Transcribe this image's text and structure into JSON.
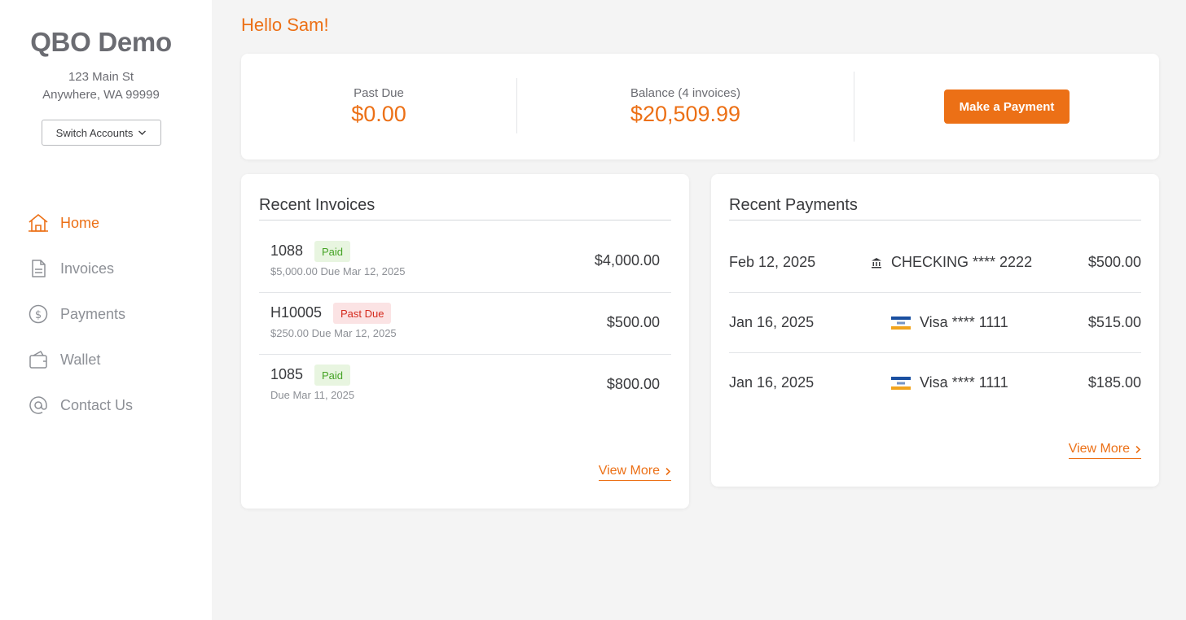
{
  "sidebar": {
    "company_name": "QBO Demo",
    "address_line1": "123 Main St",
    "address_line2": "Anywhere, WA 99999",
    "switch_accounts_label": "Switch Accounts",
    "nav": [
      {
        "label": "Home",
        "icon": "home-icon",
        "active": true
      },
      {
        "label": "Invoices",
        "icon": "document-icon",
        "active": false
      },
      {
        "label": "Payments",
        "icon": "dollar-circle-icon",
        "active": false
      },
      {
        "label": "Wallet",
        "icon": "wallet-icon",
        "active": false
      },
      {
        "label": "Contact Us",
        "icon": "at-icon",
        "active": false
      }
    ]
  },
  "greeting": "Hello Sam!",
  "summary": {
    "past_due_label": "Past Due",
    "past_due_value": "$0.00",
    "balance_label": "Balance (4 invoices)",
    "balance_value": "$20,509.99",
    "make_payment_label": "Make a Payment"
  },
  "recent_invoices": {
    "title": "Recent Invoices",
    "rows": [
      {
        "number": "1088",
        "status": "Paid",
        "subtitle": "$5,000.00 Due Mar 12, 2025",
        "amount": "$4,000.00"
      },
      {
        "number": "H10005",
        "status": "Past Due",
        "subtitle": "$250.00 Due Mar 12, 2025",
        "amount": "$500.00"
      },
      {
        "number": "1085",
        "status": "Paid",
        "subtitle": "Due Mar 11, 2025",
        "amount": "$800.00"
      }
    ],
    "view_more_label": "View More"
  },
  "recent_payments": {
    "title": "Recent Payments",
    "rows": [
      {
        "date": "Feb 12, 2025",
        "method": "CHECKING **** 2222",
        "method_icon": "bank-icon",
        "amount": "$500.00"
      },
      {
        "date": "Jan 16, 2025",
        "method": "Visa **** 1111",
        "method_icon": "visa-card-icon",
        "amount": "$515.00"
      },
      {
        "date": "Jan 16, 2025",
        "method": "Visa **** 1111",
        "method_icon": "visa-card-icon",
        "amount": "$185.00"
      }
    ],
    "view_more_label": "View More"
  },
  "colors": {
    "accent": "#ec7016",
    "paid_bg": "#e8f5e0",
    "paid_text": "#44a324",
    "due_bg": "#fbe3e4",
    "due_text": "#d52b1e"
  }
}
